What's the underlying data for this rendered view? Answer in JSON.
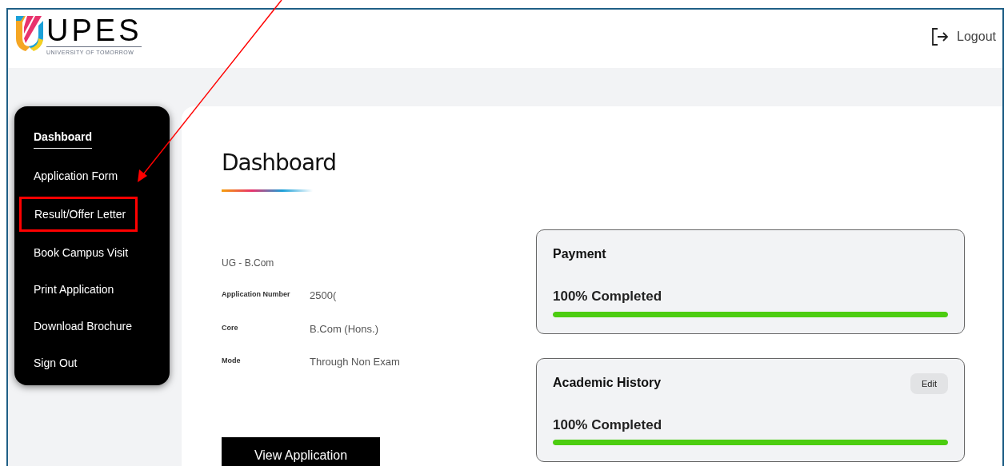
{
  "header": {
    "logo": {
      "wordmark": "UPES",
      "tagline": "UNIVERSITY OF TOMORROW"
    },
    "logout": "Logout"
  },
  "sidebar": {
    "items": [
      {
        "label": "Dashboard",
        "selected": true,
        "highlighted": false
      },
      {
        "label": "Application Form",
        "selected": false,
        "highlighted": false
      },
      {
        "label": "Result/Offer Letter",
        "selected": false,
        "highlighted": true
      },
      {
        "label": "Book Campus Visit",
        "selected": false,
        "highlighted": false
      },
      {
        "label": "Print Application",
        "selected": false,
        "highlighted": false
      },
      {
        "label": "Download Brochure",
        "selected": false,
        "highlighted": false
      },
      {
        "label": "Sign Out",
        "selected": false,
        "highlighted": false
      }
    ]
  },
  "main": {
    "title": "Dashboard",
    "program": "UG - B.Com",
    "details": [
      {
        "label": "Application Number",
        "value": "2500("
      },
      {
        "label": "Core",
        "value": "B.Com (Hons.)"
      },
      {
        "label": "Mode",
        "value": "Through Non Exam"
      }
    ],
    "view_button": "View Application",
    "cards": [
      {
        "title": "Payment",
        "status": "100% Completed",
        "level": 1.0
      },
      {
        "title": "Academic History",
        "edit": "Edit",
        "status": "100% Completed",
        "level": 1.0
      }
    ]
  }
}
